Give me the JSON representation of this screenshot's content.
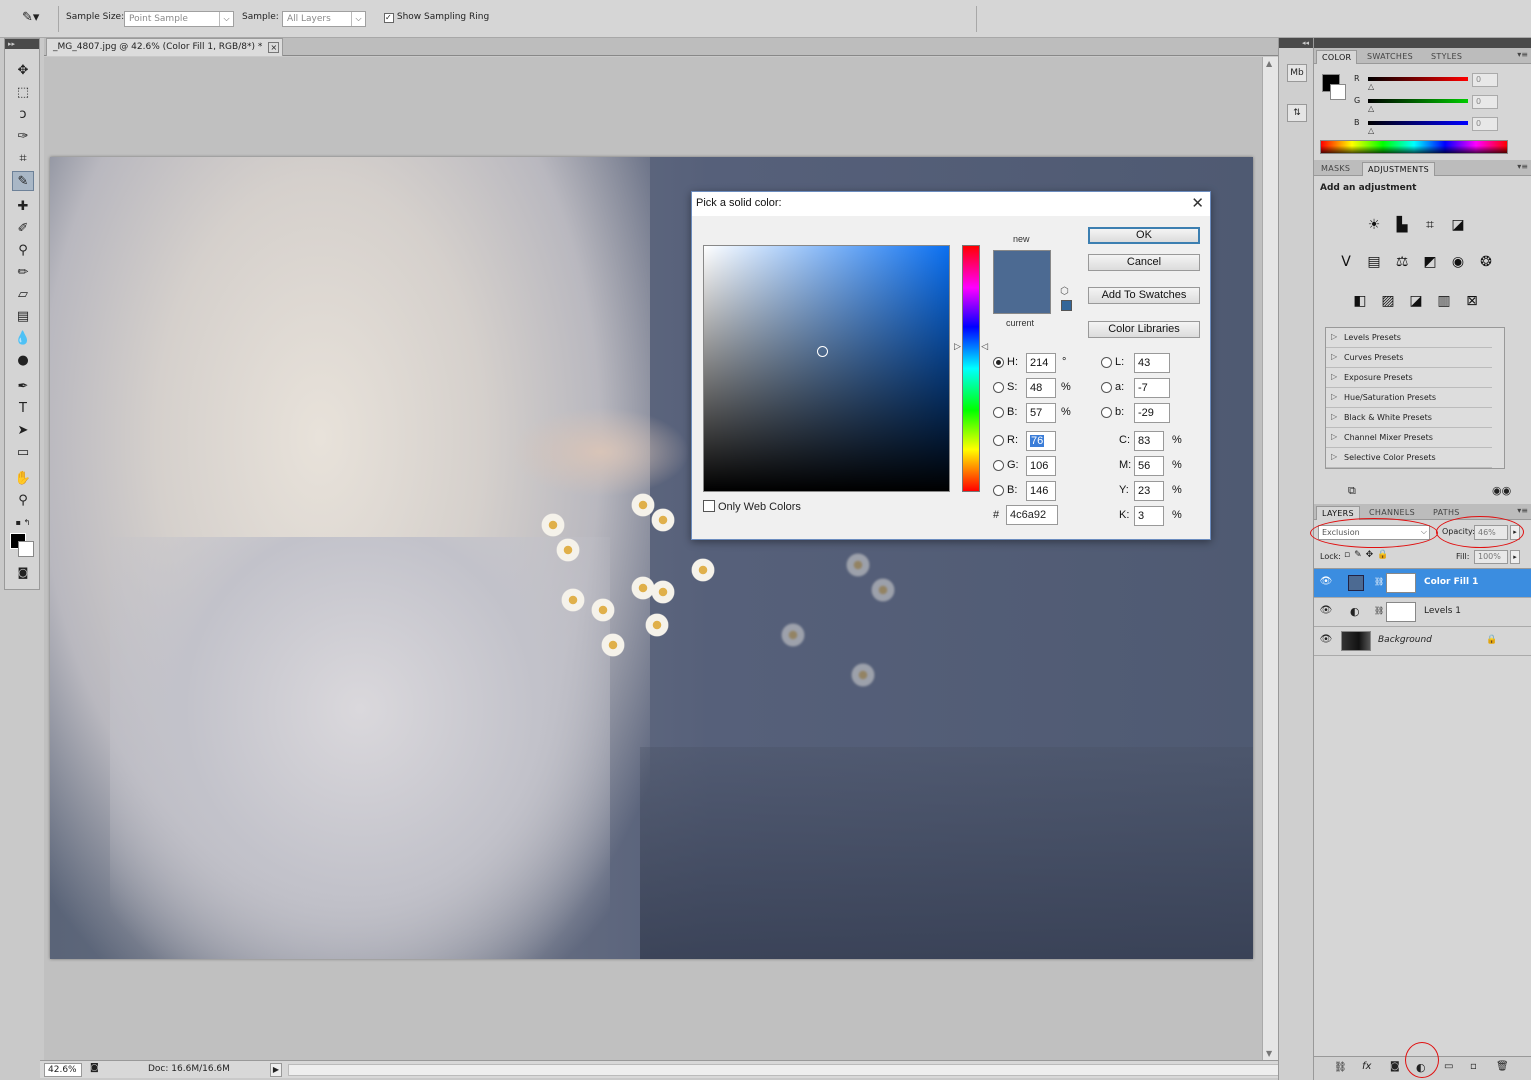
{
  "options_bar": {
    "sample_size_label": "Sample Size:",
    "sample_size_value": "Point Sample",
    "sample_label": "Sample:",
    "sample_value": "All Layers",
    "show_ring_label": "Show Sampling Ring"
  },
  "document": {
    "tab_title": "_MG_4807.jpg @ 42.6% (Color Fill 1, RGB/8*) *",
    "zoom": "42.6%",
    "doc_size": "Doc: 16.6M/16.6M"
  },
  "color_picker": {
    "title": "Pick a solid color:",
    "new_label": "new",
    "current_label": "current",
    "ok": "OK",
    "cancel": "Cancel",
    "add_to_swatches": "Add To Swatches",
    "color_libraries": "Color Libraries",
    "only_web_colors": "Only Web Colors",
    "H": "214",
    "S": "48",
    "Bv": "57",
    "R": "76",
    "G": "106",
    "B": "146",
    "L": "43",
    "a": "-7",
    "b": "-29",
    "C": "83",
    "M": "56",
    "Y": "23",
    "K": "3",
    "hex": "4c6a92",
    "new_color": "#4c6a92"
  },
  "color_panel": {
    "tabs": [
      "COLOR",
      "SWATCHES",
      "STYLES"
    ],
    "R": "0",
    "G": "0",
    "B": "0"
  },
  "adjustments_panel": {
    "tabs": [
      "MASKS",
      "ADJUSTMENTS"
    ],
    "heading": "Add an adjustment",
    "presets": [
      "Levels Presets",
      "Curves Presets",
      "Exposure Presets",
      "Hue/Saturation Presets",
      "Black & White Presets",
      "Channel Mixer Presets",
      "Selective Color Presets"
    ]
  },
  "layers_panel": {
    "tabs": [
      "LAYERS",
      "CHANNELS",
      "PATHS"
    ],
    "blend_mode": "Exclusion",
    "opacity_label": "Opacity:",
    "opacity_value": "46%",
    "lock_label": "Lock:",
    "fill_label": "Fill:",
    "fill_value": "100%",
    "layers": [
      "Color Fill 1",
      "Levels 1",
      "Background"
    ]
  },
  "colors": {
    "selection": "#3b8de0",
    "annotation": "#e01010"
  }
}
